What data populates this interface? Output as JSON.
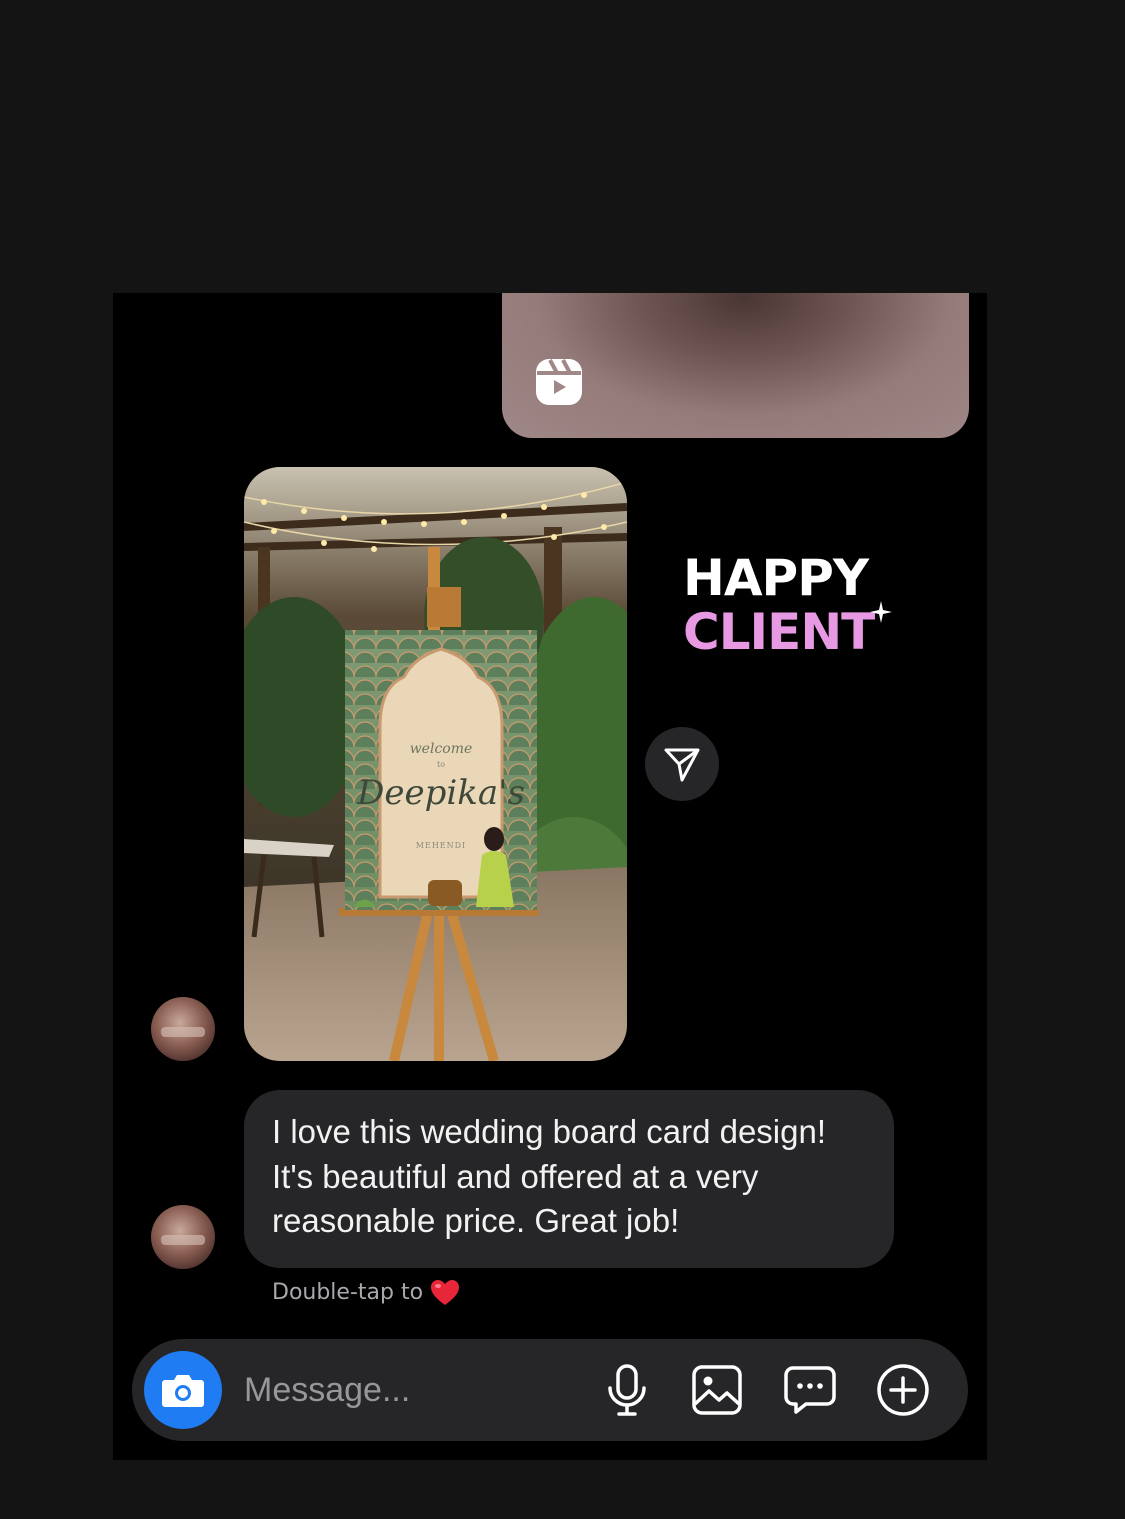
{
  "shared_reel": {
    "icon": "reels-icon"
  },
  "photo_message": {
    "sign_text_welcome": "welcome",
    "sign_text_to": "to",
    "sign_text_name": "Deepika's",
    "sign_text_event": "MEHENDI"
  },
  "overlay_text": {
    "line1": "HAPPY",
    "line2": "CLIENT"
  },
  "share_button": {
    "icon": "paper-plane-icon"
  },
  "text_message": {
    "text": "I love this wedding board card design! It's beautiful and offered at a very reasonable price. Great job!"
  },
  "reaction_hint": {
    "text": "Double-tap to",
    "icon": "red-heart-icon"
  },
  "composer": {
    "placeholder": "Message...",
    "icons": [
      "camera-icon",
      "microphone-icon",
      "image-gallery-icon",
      "sticker-message-icon",
      "plus-circle-icon"
    ]
  },
  "colors": {
    "background": "#000000",
    "bubble": "#262628",
    "accent_blue": "#1f7cf2",
    "client_pink": "#e79ae3"
  }
}
